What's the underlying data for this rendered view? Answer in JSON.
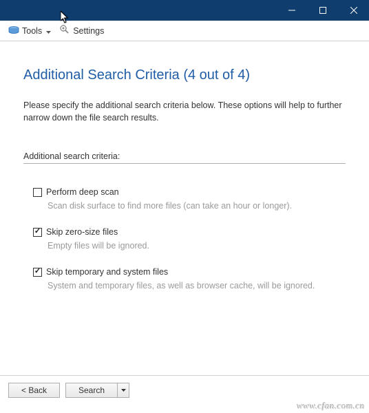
{
  "toolbar": {
    "tools_label": "Tools",
    "settings_label": "Settings"
  },
  "page": {
    "title": "Additional Search Criteria (4 out of 4)",
    "instruction": "Please specify the additional search criteria below. These options will help to further narrow down the file search results.",
    "section_label": "Additional search criteria:"
  },
  "options": [
    {
      "label": "Perform deep scan",
      "desc": "Scan disk surface to find more files (can take an hour or longer).",
      "checked": false
    },
    {
      "label": "Skip zero-size files",
      "desc": "Empty files will be ignored.",
      "checked": true
    },
    {
      "label": "Skip temporary and system files",
      "desc": "System and temporary files, as well as browser cache, will be ignored.",
      "checked": true
    }
  ],
  "footer": {
    "back_label": "<  Back",
    "search_label": "Search"
  },
  "watermark": "www.cfan.com.cn"
}
